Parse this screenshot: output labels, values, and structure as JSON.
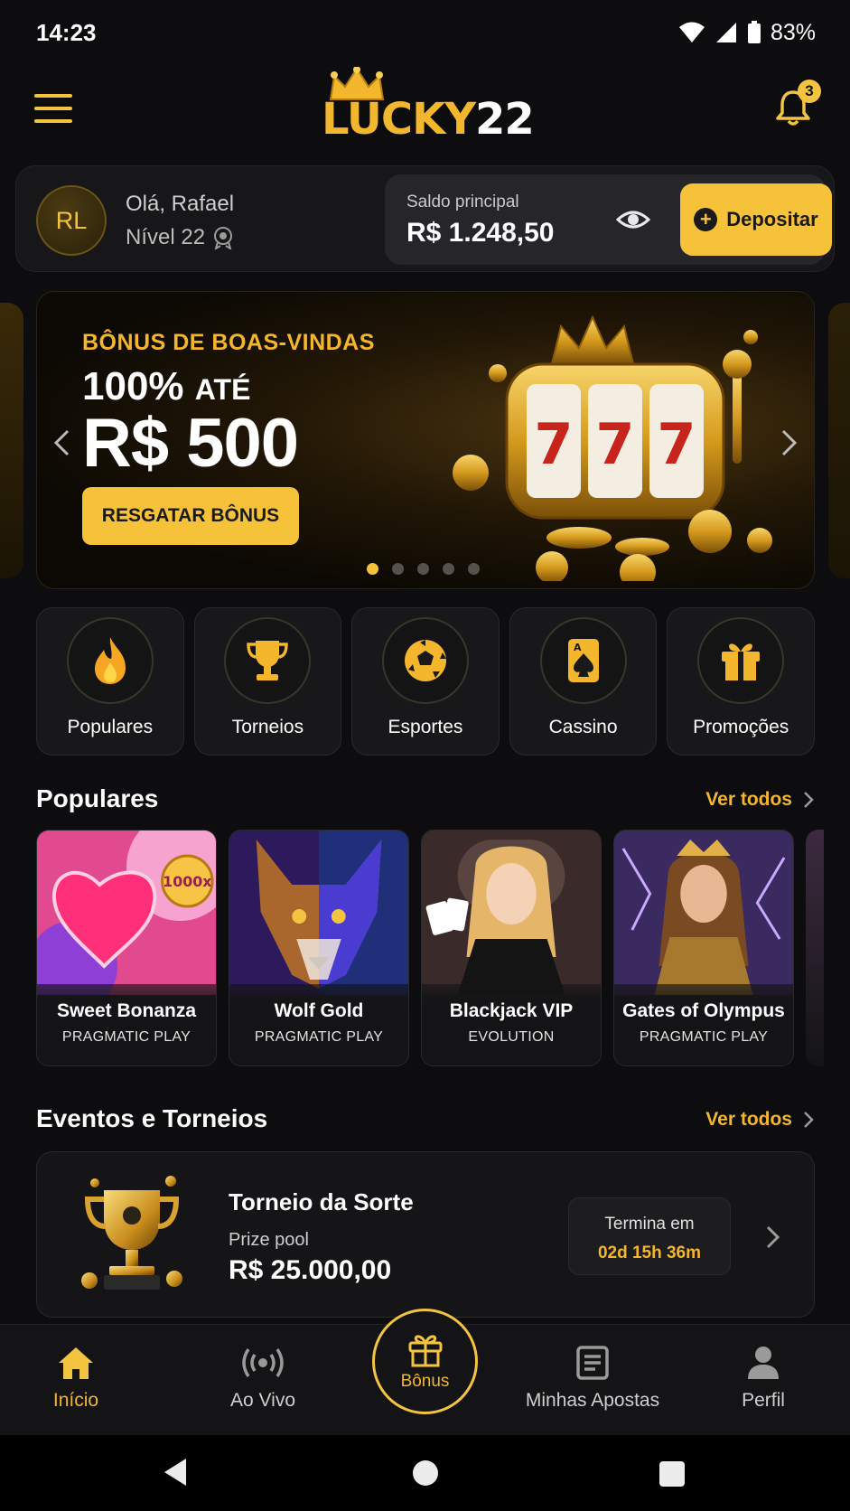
{
  "status_bar": {
    "time": "14:23",
    "battery": "83%"
  },
  "header": {
    "logo_text_a": "LUCKY",
    "logo_text_b": "22",
    "notifications": "3"
  },
  "account": {
    "initials": "RL",
    "greeting": "Olá, Rafael",
    "level": "Nível 22",
    "balance_label": "Saldo principal",
    "balance_value": "R$ 1.248,50",
    "deposit_label": "Depositar"
  },
  "banner": {
    "subtitle": "BÔNUS DE BOAS-VINDAS",
    "line1_big": "100%",
    "line1_small": "ATÉ",
    "line2": "R$ 500",
    "cta": "RESGATAR BÔNUS",
    "active_slide": 1,
    "slide_count": 5
  },
  "categories": [
    {
      "label": "Populares",
      "icon": "flame-icon"
    },
    {
      "label": "Torneios",
      "icon": "trophy-icon"
    },
    {
      "label": "Esportes",
      "icon": "soccer-ball-icon"
    },
    {
      "label": "Cassino",
      "icon": "playing-card-icon"
    },
    {
      "label": "Promoções",
      "icon": "gift-icon"
    }
  ],
  "popular": {
    "title": "Populares",
    "see_all": "Ver todos",
    "games": [
      {
        "name": "Sweet Bonanza",
        "provider": "PRAGMATIC PLAY",
        "badge": "1000x"
      },
      {
        "name": "Wolf Gold",
        "provider": "PRAGMATIC PLAY"
      },
      {
        "name": "Blackjack VIP",
        "provider": "EVOLUTION"
      },
      {
        "name": "Gates of Olympus",
        "provider": "PRAGMATIC PLAY"
      }
    ]
  },
  "events": {
    "title": "Eventos e Torneios",
    "see_all": "Ver todos",
    "event": {
      "name": "Torneio da Sorte",
      "pool_label": "Prize pool",
      "pool_value": "R$ 25.000,00",
      "ends_label": "Termina em",
      "ends_value": "02d 15h 36m"
    }
  },
  "bottom_nav": {
    "home": "Início",
    "live": "Ao Vivo",
    "bonus": "Bônus",
    "bets": "Minhas Apostas",
    "profile": "Perfil"
  },
  "colors": {
    "accent": "#F5C23A",
    "background": "#0D0D0F",
    "card": "#18181B"
  }
}
